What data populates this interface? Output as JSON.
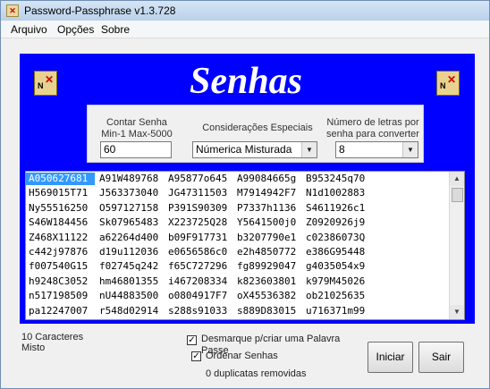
{
  "window": {
    "title": "Password-Passphrase v1.3.728"
  },
  "menu": {
    "items": [
      "Arquivo",
      "Opções",
      "Sobre"
    ]
  },
  "banner": {
    "title": "Senhas"
  },
  "options": {
    "count_label_line1": "Contar Senha",
    "count_label_line2": "Min-1 Max-5000",
    "count_value": "60",
    "special_label": "Considerações Especiais",
    "special_value": "Númerica Misturada",
    "letters_label_line1": "Número de letras por",
    "letters_label_line2": "senha para converter",
    "letters_value": "8"
  },
  "passwords": [
    [
      "A050627681",
      "A91W489768",
      "A95877o645",
      "A99084665g",
      "B953245q70"
    ],
    [
      "H569015T71",
      "J563373040",
      "JG47311503",
      "M7914942F7",
      "N1d1002883"
    ],
    [
      "Ny55516250",
      "O597127158",
      "P391S90309",
      "P7337h1136",
      "S4611926c1"
    ],
    [
      "S46W184456",
      "Sk07965483",
      "X223725Q28",
      "Y5641500j0",
      "Z0920926j9"
    ],
    [
      "Z468X11122",
      "a62264d400",
      "b09F917731",
      "b3207790e1",
      "c02386073Q"
    ],
    [
      "c442j97876",
      "d19u112036",
      "e0656586c0",
      "e2h4850772",
      "e386G95448"
    ],
    [
      "f007540G15",
      "f02745q242",
      "f65C727296",
      "fg89929047",
      "g4035054x9"
    ],
    [
      "h9248C3052",
      "hm46801355",
      "i467208334",
      "k823603801",
      "k979M45026"
    ],
    [
      "n517198509",
      "nU44883500",
      "o0804917F7",
      "oX45536382",
      "ob21025635"
    ],
    [
      "pa12247007",
      "r548d02914",
      "s288s91033",
      "s889D83015",
      "u716371m99"
    ]
  ],
  "status": {
    "chars": "10 Caracteres",
    "mode": "Misto",
    "checkbox1_label_line1": "Desmarque p/criar uma Palavra",
    "checkbox1_label_line2": "Passe",
    "checkbox2_label": "Ordenar Senhas",
    "duplicates": "0 duplicatas removidas"
  },
  "buttons": {
    "start": "Iniciar",
    "exit": "Sair"
  },
  "icons": {
    "scroll_left": "map-scroll-icon",
    "scroll_right": "map-scroll-icon",
    "dropdown": "chevron-down-icon"
  },
  "colors": {
    "panel": "#0000ff",
    "selection": "#3399ff"
  }
}
